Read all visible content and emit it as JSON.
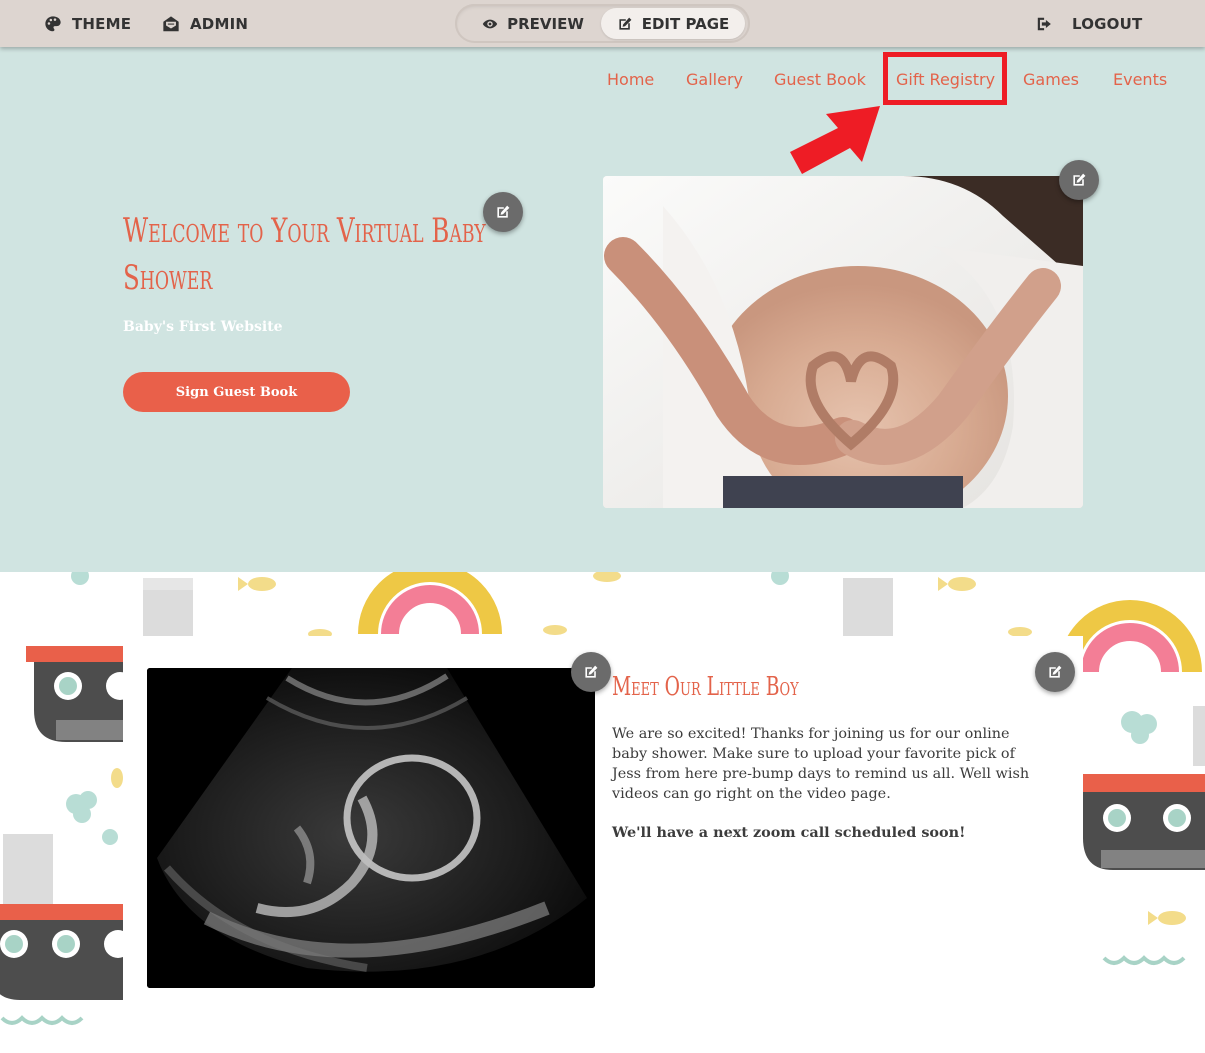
{
  "adminbar": {
    "theme_label": "THEME",
    "admin_label": "ADMIN",
    "preview_label": "PREVIEW",
    "edit_label": "EDIT PAGE",
    "logout_label": "LOGOUT",
    "active_mode": "EDIT PAGE"
  },
  "nav": {
    "items": [
      {
        "label": "Home"
      },
      {
        "label": "Gallery"
      },
      {
        "label": "Guest Book"
      },
      {
        "label": "Gift Registry",
        "highlighted": true
      },
      {
        "label": "Games"
      },
      {
        "label": "Events"
      }
    ]
  },
  "hero": {
    "title": "Welcome to Your Virtual Baby Shower",
    "subtitle": "Baby's First Website",
    "button_label": "Sign Guest Book"
  },
  "content": {
    "title": "Meet Our  Little Boy",
    "paragraph": "We are so excited! Thanks for joining us for our online baby shower.   Make sure to upload your favorite pick of Jess from here pre-bump days to remind us all. Well wish videos can go right on the video page.",
    "paragraph_bold": "We'll have a next zoom call scheduled soon!"
  },
  "colors": {
    "accent": "#e3634a",
    "hero_bg": "#d0e4e1",
    "adminbar_bg": "#ddd5d0",
    "highlight": "#ee1c25",
    "button": "#e9604a"
  },
  "icons": {
    "theme": "palette-icon",
    "admin": "envelope-open-icon",
    "preview": "eye-icon",
    "edit": "edit-icon",
    "logout": "sign-out-icon",
    "fab": "pencil-square-icon"
  }
}
